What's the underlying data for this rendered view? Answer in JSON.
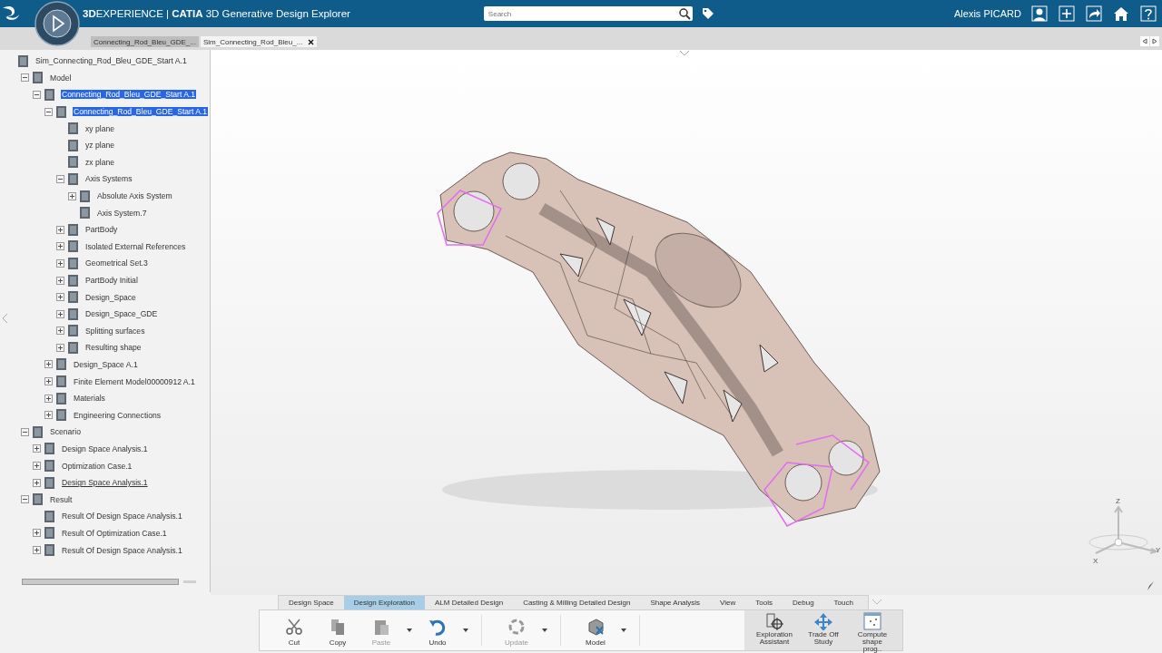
{
  "header": {
    "title": "**3D**EXPERIENCE | **CATIA** 3D Generative Design Explorer",
    "search": {
      "placeholder": "Search"
    },
    "user": "Alexis PICARD"
  },
  "doc_tabs": [
    {
      "label": "Connecting_Rod_Bleu_GDE_...",
      "selected": false,
      "closable": false
    },
    {
      "label": "Sim_Connecting_Rod_Bleu_...",
      "selected": true,
      "closable": true
    }
  ],
  "tree": {
    "label": "Sim_Connecting_Rod_Bleu_GDE_Start A.1",
    "kind": "root",
    "selected": false,
    "current": false,
    "children": [
      {
        "label": "Model",
        "kind": "node",
        "expanded": true,
        "selected": false,
        "current": false,
        "children": [
          {
            "label": "Connecting_Rod_Bleu_GDE_Start A.1",
            "kind": "node",
            "expanded": true,
            "selected": true,
            "current": false,
            "children": [
              {
                "label": "Connecting_Rod_Bleu_GDE_Start A.1",
                "kind": "node",
                "expanded": true,
                "selected": true,
                "current": false,
                "children": [
                  {
                    "label": "xy plane",
                    "kind": "leaf",
                    "selected": false,
                    "current": false
                  },
                  {
                    "label": "yz plane",
                    "kind": "leaf",
                    "selected": false,
                    "current": false
                  },
                  {
                    "label": "zx plane",
                    "kind": "leaf",
                    "selected": false,
                    "current": false
                  },
                  {
                    "label": "Axis Systems",
                    "kind": "node",
                    "expanded": true,
                    "selected": false,
                    "current": false,
                    "children": [
                      {
                        "label": "Absolute Axis System",
                        "kind": "node",
                        "expanded": false,
                        "selected": false,
                        "current": false
                      },
                      {
                        "label": "Axis System.7",
                        "kind": "leaf",
                        "selected": false,
                        "current": false
                      }
                    ]
                  },
                  {
                    "label": "PartBody",
                    "kind": "node",
                    "expanded": false,
                    "selected": false,
                    "current": false
                  },
                  {
                    "label": "Isolated External References",
                    "kind": "node",
                    "expanded": false,
                    "selected": false,
                    "current": false
                  },
                  {
                    "label": "Geometrical Set.3",
                    "kind": "node",
                    "expanded": false,
                    "selected": false,
                    "current": false
                  },
                  {
                    "label": "PartBody Initial",
                    "kind": "node",
                    "expanded": false,
                    "selected": false,
                    "current": false
                  },
                  {
                    "label": "Design_Space",
                    "kind": "node",
                    "expanded": false,
                    "selected": false,
                    "current": false
                  },
                  {
                    "label": "Design_Space_GDE",
                    "kind": "node",
                    "expanded": false,
                    "selected": false,
                    "current": false
                  },
                  {
                    "label": "Splitting surfaces",
                    "kind": "node",
                    "expanded": false,
                    "selected": false,
                    "current": false
                  },
                  {
                    "label": "Resulting shape",
                    "kind": "node",
                    "expanded": false,
                    "selected": false,
                    "current": false
                  }
                ]
              },
              {
                "label": "Design_Space A.1",
                "kind": "node",
                "expanded": false,
                "selected": false,
                "current": false
              },
              {
                "label": "Finite Element Model00000912 A.1",
                "kind": "node",
                "expanded": false,
                "selected": false,
                "current": false
              },
              {
                "label": "Materials",
                "kind": "node",
                "expanded": false,
                "selected": false,
                "current": false
              },
              {
                "label": "Engineering Connections",
                "kind": "node",
                "expanded": false,
                "selected": false,
                "current": false
              }
            ]
          }
        ]
      },
      {
        "label": "Scenario",
        "kind": "node",
        "expanded": true,
        "selected": false,
        "current": false,
        "children": [
          {
            "label": "Design Space Analysis.1",
            "kind": "node",
            "expanded": false,
            "selected": false,
            "current": false
          },
          {
            "label": "Optimization Case.1",
            "kind": "node",
            "expanded": false,
            "selected": false,
            "current": false
          },
          {
            "label": "Design Space Analysis.1",
            "kind": "node",
            "expanded": false,
            "selected": false,
            "current": true
          }
        ]
      },
      {
        "label": "Result",
        "kind": "node",
        "expanded": true,
        "selected": false,
        "current": false,
        "children": [
          {
            "label": "Result Of Design Space Analysis.1",
            "kind": "leaf",
            "selected": false,
            "current": false
          },
          {
            "label": "Result Of Optimization Case.1",
            "kind": "node",
            "expanded": false,
            "selected": false,
            "current": false
          },
          {
            "label": "Result Of Design Space Analysis.1",
            "kind": "node",
            "expanded": false,
            "selected": false,
            "current": false
          }
        ]
      }
    ]
  },
  "viewport": {
    "triad": {
      "z": "Z",
      "x": "X",
      "y": "Y"
    }
  },
  "action_bar": {
    "tabs": [
      {
        "label": "Design Space",
        "selected": false
      },
      {
        "label": "Design Exploration",
        "selected": true
      },
      {
        "label": "ALM Detailed Design",
        "selected": false
      },
      {
        "label": "Casting & Milling Detailed Design",
        "selected": false
      },
      {
        "label": "Shape Analysis",
        "selected": false
      },
      {
        "label": "View",
        "selected": false
      },
      {
        "label": "Tools",
        "selected": false
      },
      {
        "label": "Debug",
        "selected": false
      },
      {
        "label": "Touch",
        "selected": false
      }
    ],
    "groups": [
      {
        "kind": "standard",
        "buttons": [
          {
            "label": "Cut",
            "menu": false,
            "disabled": false
          },
          {
            "label": "Copy",
            "menu": false,
            "disabled": false
          },
          {
            "label": "Paste",
            "menu": true,
            "disabled": true
          },
          {
            "label": "Undo",
            "menu": true,
            "disabled": false
          }
        ]
      },
      {
        "kind": "standard",
        "buttons": [
          {
            "label": "Update",
            "menu": true,
            "disabled": true
          }
        ]
      },
      {
        "kind": "standard",
        "buttons": [
          {
            "label": "Model",
            "menu": true,
            "disabled": false
          }
        ]
      },
      {
        "kind": "app",
        "buttons": [
          {
            "label": "Exploration Assistant",
            "menu": false,
            "disabled": false
          },
          {
            "label": "Trade Off Study",
            "menu": false,
            "disabled": false
          },
          {
            "label": "Compute shape prog..",
            "menu": false,
            "disabled": false
          }
        ]
      }
    ]
  }
}
